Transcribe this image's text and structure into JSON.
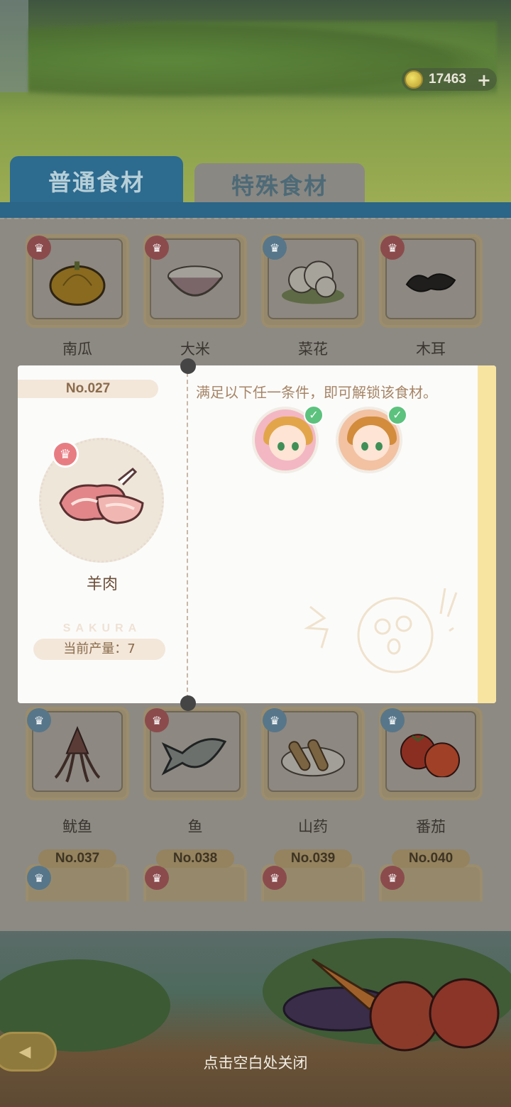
{
  "currency": {
    "amount": "17463",
    "plus": "+"
  },
  "tabs": {
    "normal": "普通食材",
    "special": "特殊食材"
  },
  "grid": {
    "row1": [
      {
        "name": "南瓜",
        "badge": "red",
        "icon": "pumpkin-icon"
      },
      {
        "name": "大米",
        "badge": "red",
        "icon": "rice-icon"
      },
      {
        "name": "菜花",
        "badge": "blue",
        "icon": "cauliflower-icon"
      },
      {
        "name": "木耳",
        "badge": "red",
        "icon": "wood-ear-icon"
      }
    ],
    "row2": [
      {
        "name": "鱿鱼",
        "badge": "blue",
        "icon": "squid-icon"
      },
      {
        "name": "鱼",
        "badge": "red",
        "icon": "fish-icon"
      },
      {
        "name": "山药",
        "badge": "blue",
        "icon": "yam-icon"
      },
      {
        "name": "番茄",
        "badge": "blue",
        "icon": "tomato-icon"
      }
    ],
    "row3": [
      {
        "no": "No.037",
        "badge": "blue"
      },
      {
        "no": "No.038",
        "badge": "red"
      },
      {
        "no": "No.039",
        "badge": "red"
      },
      {
        "no": "No.040",
        "badge": "red"
      }
    ]
  },
  "modal": {
    "number": "No.027",
    "item_name": "羊肉",
    "brand": "SAKURA",
    "production": "当前产量：7",
    "condition_text": "满足以下任一条件，即可解锁该食材。",
    "conditions": [
      {
        "character": "sakura-avatar-1",
        "done": true
      },
      {
        "character": "sakura-avatar-2",
        "done": true
      }
    ]
  },
  "close_hint": "点击空白处关闭",
  "colors": {
    "tab_active": "#2d6b8f",
    "check": "#5cc27d",
    "accent_yellow": "#f7e4a1"
  }
}
